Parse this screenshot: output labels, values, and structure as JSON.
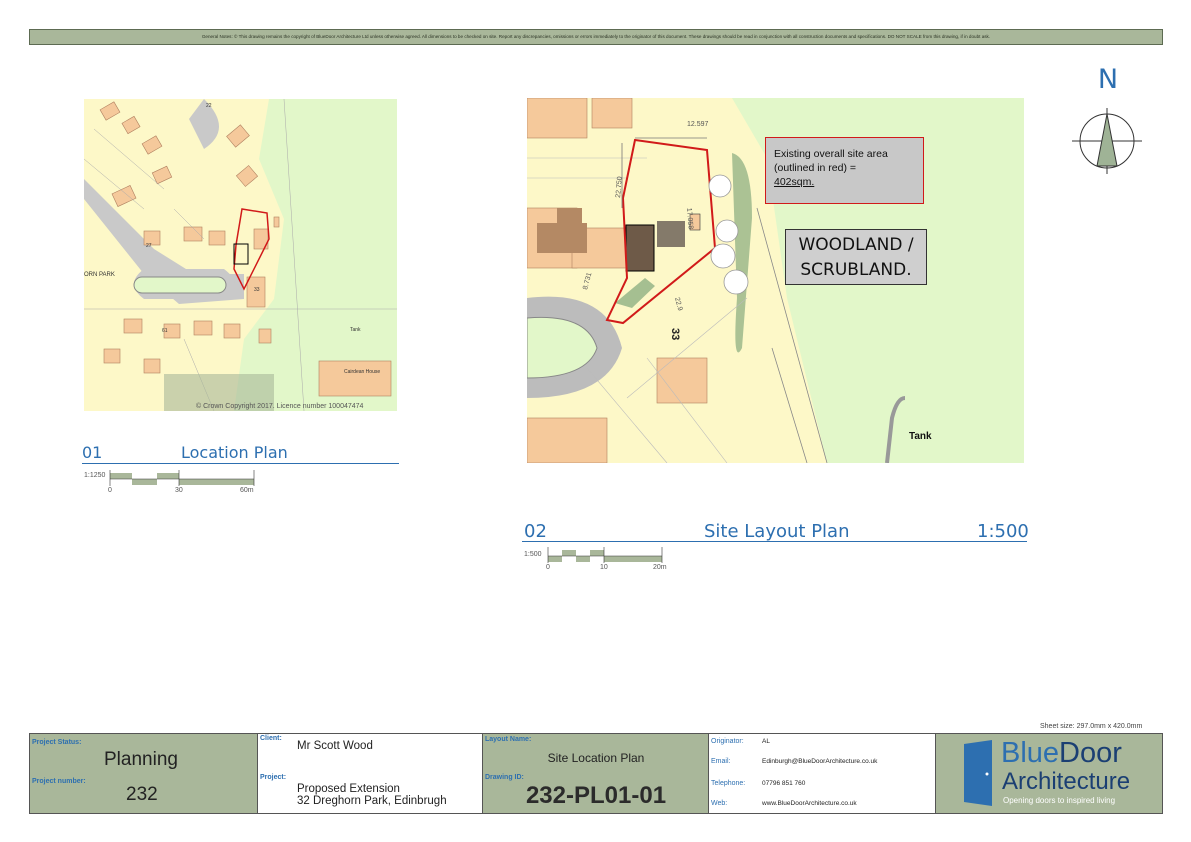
{
  "general_notes": "General Notes: © This drawing remains the copyright of BlueDoor Architecture Ltd unless otherwise agreed. All dimensions to be checked on site. Report any discrepancies, omissions or errors immediately to the originator of this document.  These drawings should be read in conjunction with all construction documents and specifications.  DO NOT SCALE from this drawing, if in doubt ask.",
  "north_label": "N",
  "location_plan": {
    "number": "01",
    "title": "Location Plan",
    "scale_label": "1:1250",
    "ticks": [
      "0",
      "30",
      "60m"
    ],
    "copyright": "© Crown Copyright 2017. Licence number 100047474",
    "labels": {
      "street": "ORN PARK",
      "house27": "27",
      "house33": "33",
      "house61": "61",
      "house22": "22",
      "tank": "Tank",
      "cairdean": "Cairdean House"
    }
  },
  "site_plan": {
    "number": "02",
    "title": "Site Layout Plan",
    "scale": "1:500",
    "scale_label": "1:500",
    "ticks": [
      "0",
      "10",
      "20m"
    ],
    "dimensions": {
      "top": "12.597",
      "left": "22.750",
      "right": "17.058",
      "bottom": "8.731",
      "side": "22.9"
    },
    "house_number": "33",
    "callout": {
      "line1": "Existing overall site area",
      "line2": "(outlined in red) =",
      "line3": "402sqm."
    },
    "woodland": {
      "line1": "WOODLAND /",
      "line2": "SCRUBLAND."
    },
    "tank": "Tank"
  },
  "sheet_size": "Sheet size: 297.0mm x 420.0mm",
  "title_block": {
    "project_status_label": "Project Status:",
    "project_status": "Planning",
    "project_number_label": "Project number:",
    "project_number": "232",
    "client_label": "Client:",
    "client": "Mr Scott Wood",
    "project_label": "Project:",
    "project_line1": "Proposed Extension",
    "project_line2": "32 Dreghorn Park, Edinbrugh",
    "layout_name_label": "Layout Name:",
    "layout_name": "Site Location Plan",
    "drawing_id_label": "Drawing ID:",
    "drawing_id": "232-PL01-01",
    "originator_label": "Originator:",
    "originator": "AL",
    "email_label": "Email:",
    "email": "Edinburgh@BlueDoorArchitecture.co.uk",
    "telephone_label": "Telephone:",
    "telephone": "07796 851 760",
    "web_label": "Web:",
    "web": "www.BlueDoorArchitecture.co.uk"
  },
  "logo": {
    "word_blue": "Blue",
    "word_door": "Door",
    "word2": "Architecture",
    "tagline": "Opening doors to inspired living"
  },
  "colors": {
    "accent_blue": "#2d6fb0",
    "title_block_green": "#a9b79a",
    "site_outline_red": "#d11a1a",
    "map_yellow": "#fdf8c8",
    "map_green": "#e2f7c9"
  }
}
